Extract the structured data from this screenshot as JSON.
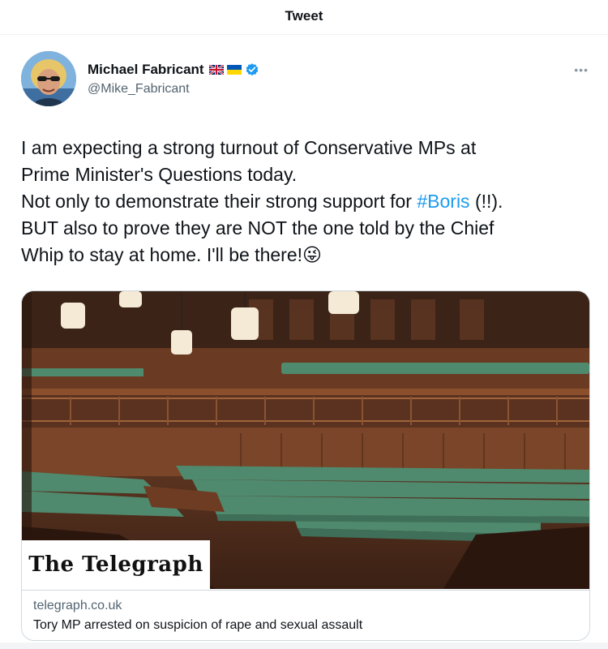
{
  "header": {
    "title": "Tweet"
  },
  "author": {
    "name": "Michael Fabricant",
    "handle": "@Mike_Fabricant",
    "badges": [
      "uk-flag-icon",
      "ukraine-flag-icon",
      "verified-badge-icon"
    ]
  },
  "tweet": {
    "line1": "I am expecting a strong turnout of Conservative MPs at",
    "line2": "Prime Minister's Questions today.",
    "line3_pre": "Not only to demonstrate their strong support for ",
    "hashtag": "#Boris",
    "line3_post": " (!!).",
    "line4": "BUT also to prove they are NOT the one told by the Chief",
    "line5": "Whip to stay at home.  I'll be there!",
    "emoji": "😜"
  },
  "card": {
    "brand": "The Telegraph",
    "domain": "telegraph.co.uk",
    "title": "Tory MP arrested on suspicion of rape and sexual assault"
  },
  "colors": {
    "link": "#1d9bf0",
    "verified": "#1d9bf0",
    "bench_green": "#4f8a6e",
    "wood": "#6b3a22"
  }
}
